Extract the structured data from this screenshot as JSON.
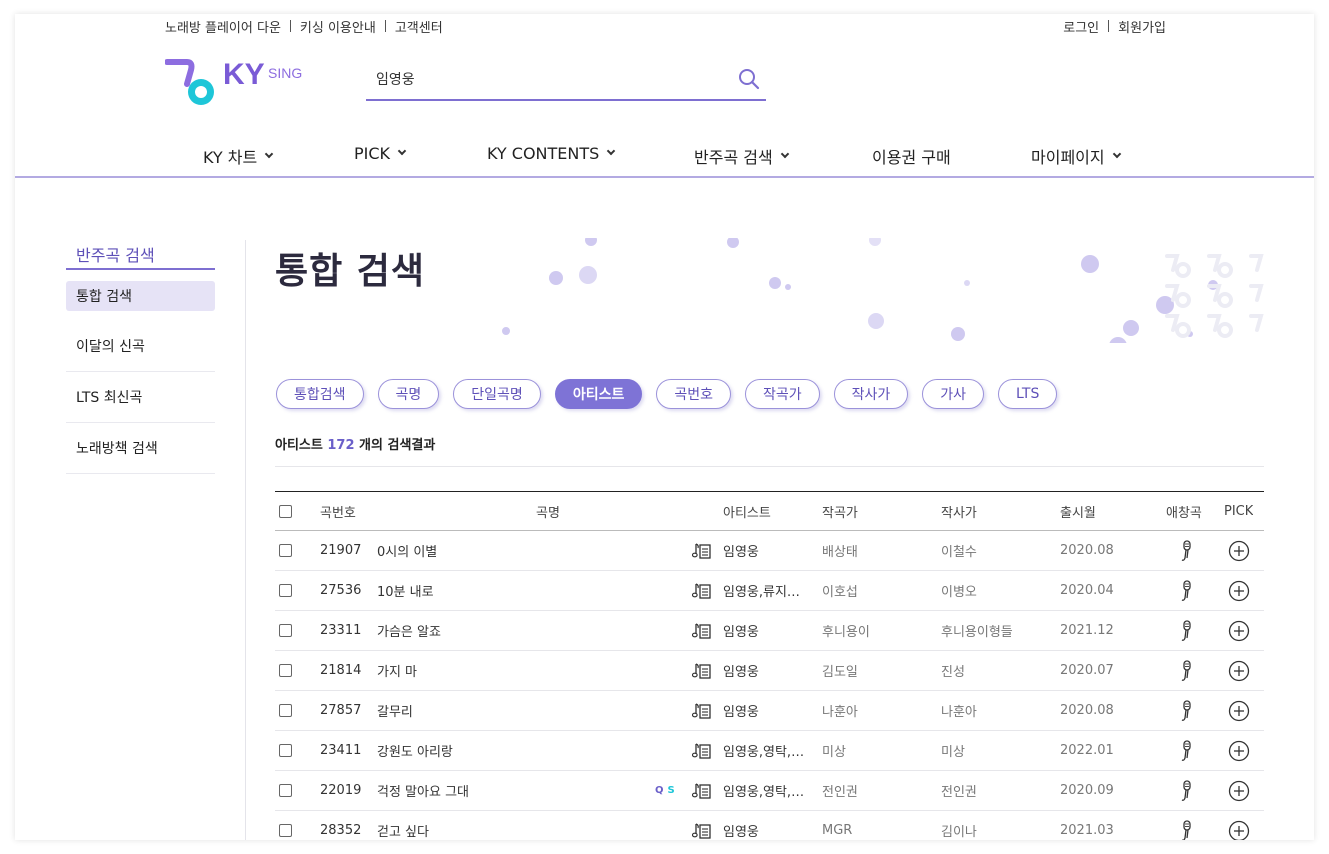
{
  "util": {
    "left": [
      "노래방 플레이어 다운",
      "키싱 이용안내",
      "고객센터"
    ],
    "right": [
      "로그인",
      "회원가입"
    ]
  },
  "logo": {
    "text": "KY",
    "sub": "SING"
  },
  "search": {
    "value": "임영웅"
  },
  "nav": [
    "KY 차트",
    "PICK",
    "KY CONTENTS",
    "반주곡 검색",
    "이용권 구매",
    "마이페이지"
  ],
  "sidebar": {
    "title": "반주곡 검색",
    "items": [
      "통합 검색",
      "이달의 신곡",
      "LTS 최신곡",
      "노래방책 검색"
    ]
  },
  "page_title": "통합 검색",
  "tabs": [
    "통합검색",
    "곡명",
    "단일곡명",
    "아티스트",
    "곡번호",
    "작곡가",
    "작사가",
    "가사",
    "LTS"
  ],
  "active_tab": "아티스트",
  "result": {
    "prefix": "아티스트",
    "count": "172",
    "suffix": "개의 검색결과"
  },
  "table": {
    "headers": [
      "곡번호",
      "곡명",
      "아티스트",
      "작곡가",
      "작사가",
      "출시월",
      "애창곡",
      "PICK"
    ],
    "rows": [
      {
        "no": "21907",
        "title": "0시의 이별",
        "artist": "임영웅",
        "composer": "배상태",
        "lyricist": "이철수",
        "date": "2020.08",
        "qs": false
      },
      {
        "no": "27536",
        "title": "10분 내로",
        "artist": "임영웅,류지…",
        "composer": "이호섭",
        "lyricist": "이병오",
        "date": "2020.04",
        "qs": false
      },
      {
        "no": "23311",
        "title": "가슴은 알죠",
        "artist": "임영웅",
        "composer": "후니용이",
        "lyricist": "후니용이형들",
        "date": "2021.12",
        "qs": false
      },
      {
        "no": "21814",
        "title": "가지 마",
        "artist": "임영웅",
        "composer": "김도일",
        "lyricist": "진성",
        "date": "2020.07",
        "qs": false
      },
      {
        "no": "27857",
        "title": "갈무리",
        "artist": "임영웅",
        "composer": "나훈아",
        "lyricist": "나훈아",
        "date": "2020.08",
        "qs": false
      },
      {
        "no": "23411",
        "title": "강원도 아리랑",
        "artist": "임영웅,영탁,…",
        "composer": "미상",
        "lyricist": "미상",
        "date": "2022.01",
        "qs": false
      },
      {
        "no": "22019",
        "title": "걱정 말아요 그대",
        "artist": "임영웅,영탁,…",
        "composer": "전인권",
        "lyricist": "전인권",
        "date": "2020.09",
        "qs": true
      },
      {
        "no": "28352",
        "title": "걷고 싶다",
        "artist": "임영웅",
        "composer": "MGR",
        "lyricist": "김이나",
        "date": "2021.03",
        "qs": false
      }
    ],
    "qs_labels": [
      "Q",
      "S"
    ]
  },
  "colors": {
    "accent": "#7e73d6",
    "brand_teal": "#1ec6d8",
    "brand_purple": "#7a5bd6"
  },
  "icons": [
    "search-icon",
    "chevron-down-icon",
    "score-sheet-icon",
    "microphone-icon",
    "plus-circle-icon"
  ]
}
